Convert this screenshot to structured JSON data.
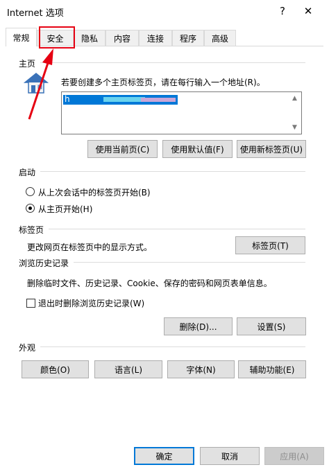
{
  "window": {
    "title": "Internet 选项",
    "help_glyph": "?",
    "close_glyph": "✕"
  },
  "tabs": [
    {
      "label": "常规",
      "active": true
    },
    {
      "label": "安全",
      "active": false
    },
    {
      "label": "隐私",
      "active": false
    },
    {
      "label": "内容",
      "active": false
    },
    {
      "label": "连接",
      "active": false
    },
    {
      "label": "程序",
      "active": false
    },
    {
      "label": "高级",
      "active": false
    }
  ],
  "homepage": {
    "section": "主页",
    "instruction": "若要创建多个主页标签页，请在每行输入一个地址(R)。",
    "url_value": "h",
    "use_current": "使用当前页(C)",
    "use_default": "使用默认值(F)",
    "use_new_tab": "使用新标签页(U)"
  },
  "startup": {
    "section": "启动",
    "option1": "从上次会话中的标签页开始(B)",
    "option2": "从主页开始(H)",
    "selected": "option2"
  },
  "tabs_section": {
    "section": "标签页",
    "description": "更改网页在标签页中的显示方式。",
    "button": "标签页(T)"
  },
  "history": {
    "section": "浏览历史记录",
    "description": "删除临时文件、历史记录、Cookie、保存的密码和网页表单信息。",
    "checkbox_label": "退出时删除浏览历史记录(W)",
    "checkbox_checked": false,
    "delete_button": "删除(D)...",
    "settings_button": "设置(S)"
  },
  "appearance": {
    "section": "外观",
    "colors": "颜色(O)",
    "languages": "语言(L)",
    "fonts": "字体(N)",
    "accessibility": "辅助功能(E)"
  },
  "footer": {
    "ok": "确定",
    "cancel": "取消",
    "apply": "应用(A)"
  },
  "colors": {
    "accent": "#0078d7",
    "annotation": "#e60012"
  }
}
